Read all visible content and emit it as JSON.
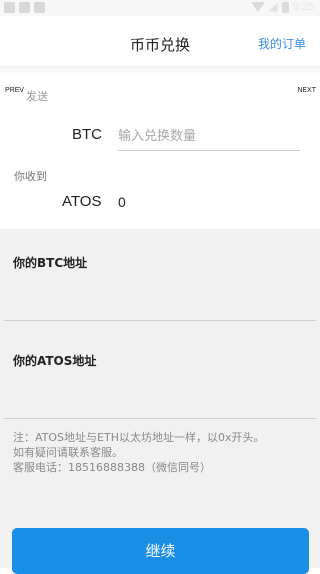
{
  "status_bar": {
    "time": "9:25",
    "icons": [
      "notification-icon",
      "notification-icon",
      "image-icon",
      "wifi-icon",
      "signal-icon",
      "battery-icon"
    ]
  },
  "navbar": {
    "title": "币币兑换",
    "orders_link": "我的订单"
  },
  "pager": {
    "prev": "PREV",
    "next": "NEXT"
  },
  "send": {
    "label": "发送",
    "currency": "BTC",
    "amount_placeholder": "输入兑换数量",
    "amount_value": ""
  },
  "receive": {
    "label": "你收到",
    "currency": "ATOS",
    "amount": "0"
  },
  "btc_address": {
    "title": "你的BTC地址",
    "value": ""
  },
  "atos_address": {
    "title": "你的ATOS地址",
    "value": ""
  },
  "note": {
    "line1": "注：ATOS地址与ETH以太坊地址一样，以0x开头。",
    "line2": "如有疑问请联系客服。",
    "line3": "客服电话：18516888388（微信同号）"
  },
  "continue_button": "继续",
  "colors": {
    "accent": "#1b8ee6",
    "link": "#3f8cd8",
    "panel_bg": "#f1f1f1"
  }
}
